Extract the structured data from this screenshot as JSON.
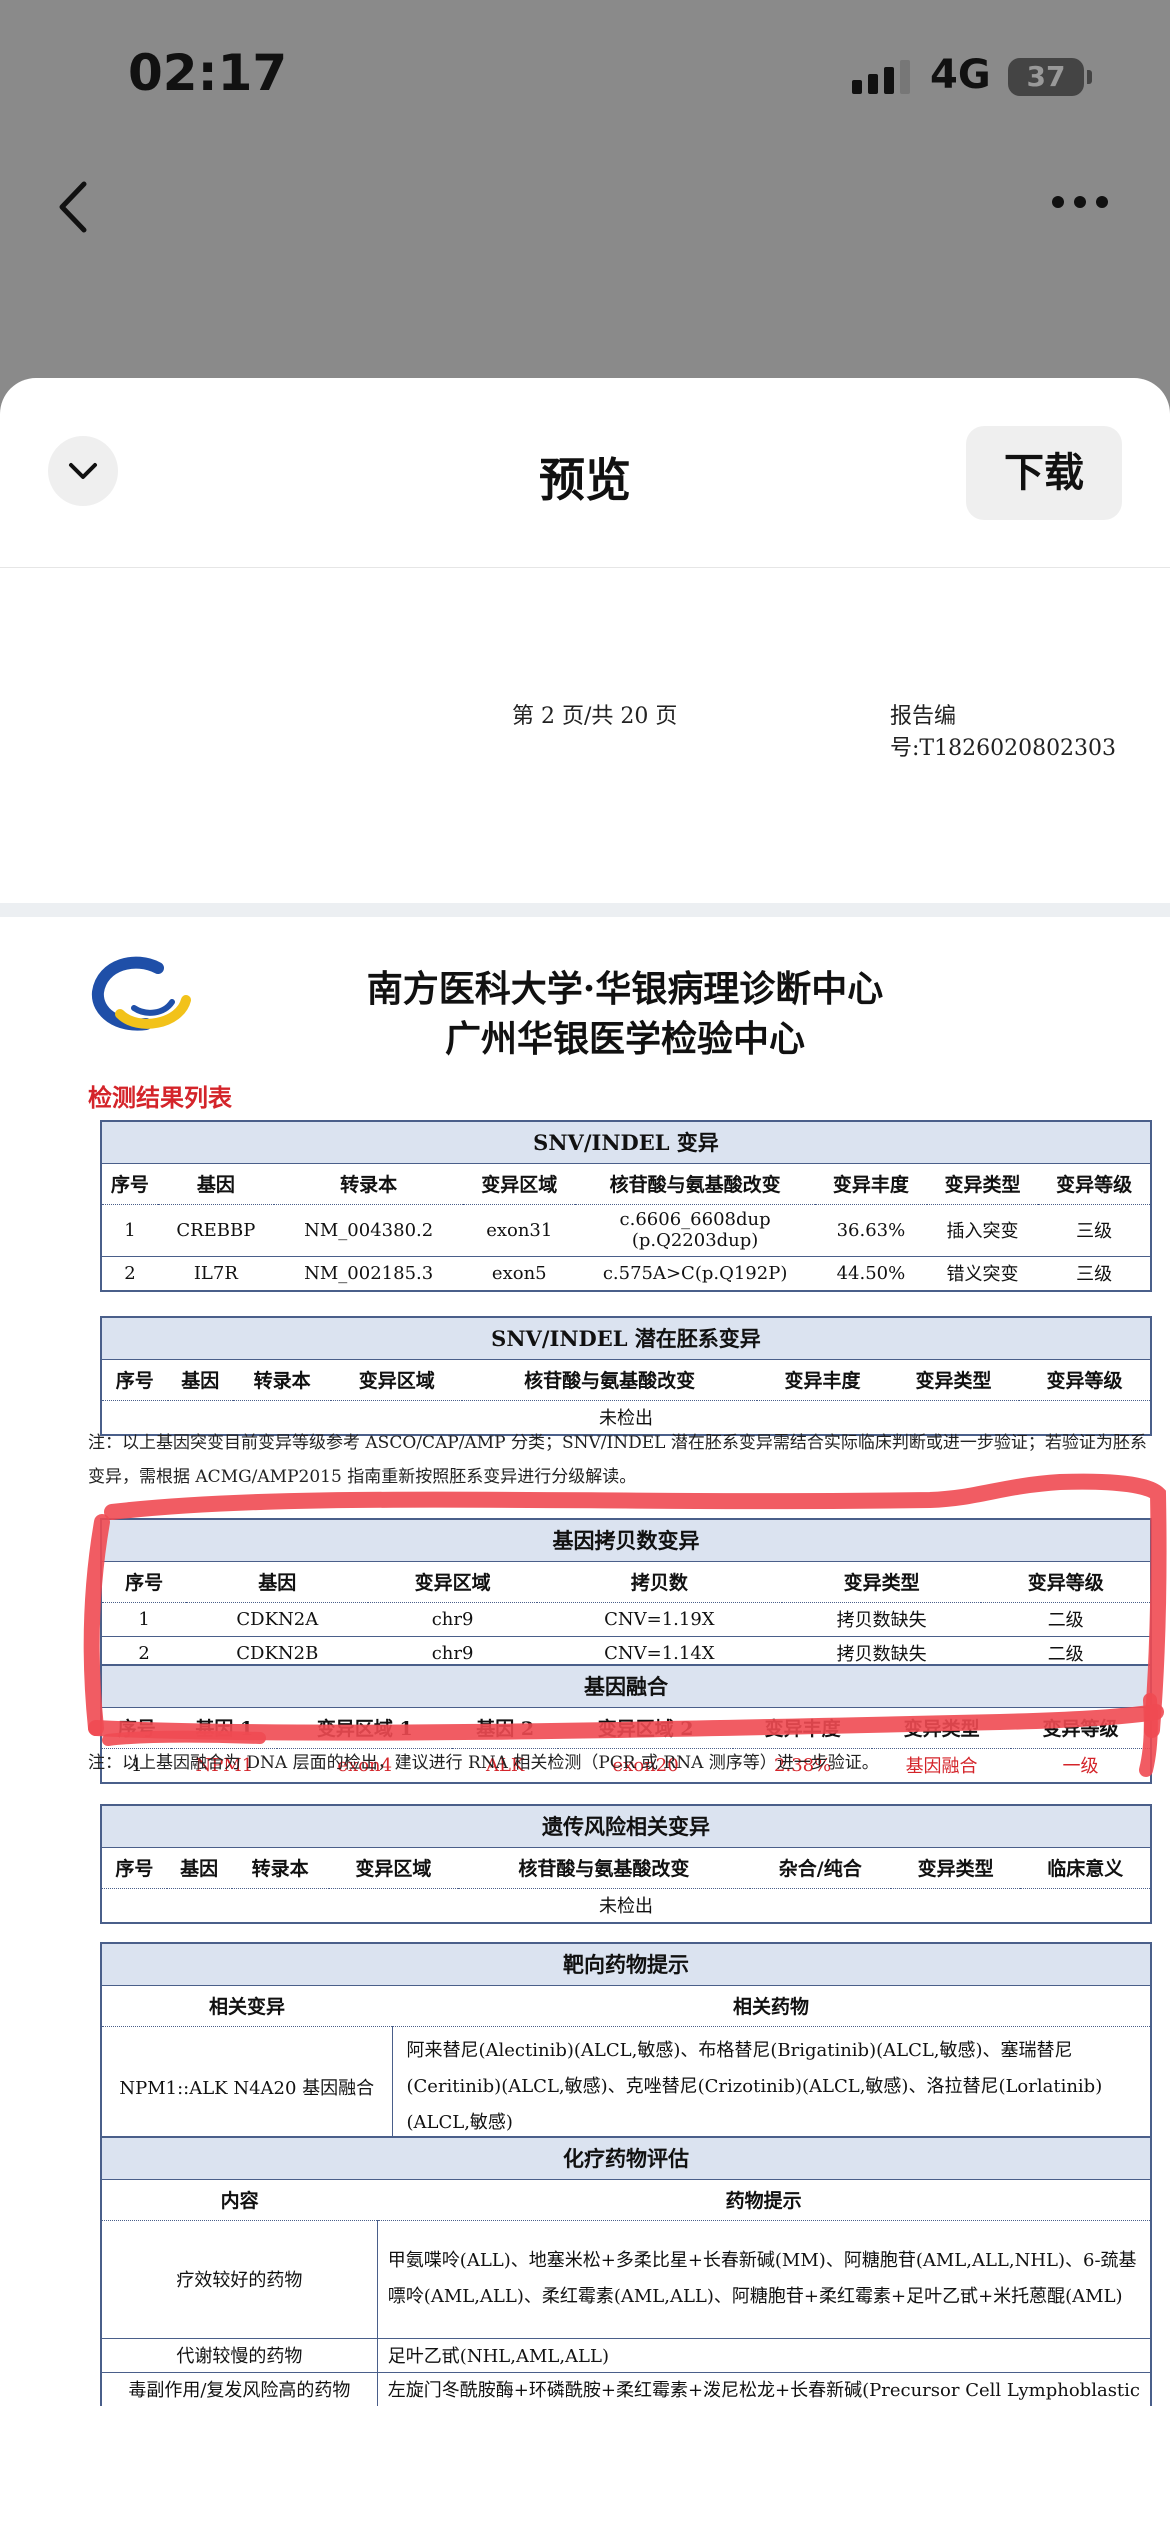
{
  "status": {
    "time": "02:17",
    "network": "4G",
    "battery": "37"
  },
  "sheet": {
    "title": "预览",
    "download_label": "下载"
  },
  "page_meta": {
    "page": "第 2 页/共 20 页",
    "report_no": "报告编号:T1826020802303"
  },
  "document": {
    "org_line1": "南方医科大学·华银病理诊断中心",
    "org_line2": "广州华银医学检验中心",
    "section_title": "检测结果列表",
    "snv": {
      "title": "SNV/INDEL 变异",
      "headers": [
        "序号",
        "基因",
        "转录本",
        "变异区域",
        "核苷酸与氨基酸改变",
        "变异丰度",
        "变异类型",
        "变异等级"
      ],
      "rows": [
        [
          "1",
          "CREBBP",
          "NM_004380.2",
          "exon31",
          "c.6606_6608dup (p.Q2203dup)",
          "36.63%",
          "插入突变",
          "三级"
        ],
        [
          "2",
          "IL7R",
          "NM_002185.3",
          "exon5",
          "c.575A>C(p.Q192P)",
          "44.50%",
          "错义突变",
          "三级"
        ]
      ]
    },
    "germline": {
      "title": "SNV/INDEL 潜在胚系变异",
      "headers": [
        "序号",
        "基因",
        "转录本",
        "变异区域",
        "核苷酸与氨基酸改变",
        "变异丰度",
        "变异类型",
        "变异等级"
      ],
      "empty": "未检出"
    },
    "note1": "注：以上基因突变目前变异等级参考 ASCO/CAP/AMP 分类；SNV/INDEL 潜在胚系变异需结合实际临床判断或进一步验证；若验证为胚系变异，需根据 ACMG/AMP2015 指南重新按照胚系变异进行分级解读。",
    "cnv": {
      "title": "基因拷贝数变异",
      "headers": [
        "序号",
        "基因",
        "变异区域",
        "拷贝数",
        "变异类型",
        "变异等级"
      ],
      "rows": [
        [
          "1",
          "CDKN2A",
          "chr9",
          "CNV=1.19X",
          "拷贝数缺失",
          "二级"
        ],
        [
          "2",
          "CDKN2B",
          "chr9",
          "CNV=1.14X",
          "拷贝数缺失",
          "二级"
        ]
      ]
    },
    "fusion": {
      "title": "基因融合",
      "headers": [
        "序号",
        "基因 1",
        "变异区域 1",
        "基因 2",
        "变异区域 2",
        "变异丰度",
        "变异类型",
        "变异等级"
      ],
      "rows": [
        [
          "1",
          "NPM1",
          "exon4",
          "ALK",
          "exon20",
          "2.38%",
          "基因融合",
          "一级"
        ]
      ]
    },
    "note2": "注：以上基因融合为 DNA 层面的检出，建议进行 RNA 相关检测（PCR 或 RNA 测序等）进一步验证。",
    "hereditary": {
      "title": "遗传风险相关变异",
      "headers": [
        "序号",
        "基因",
        "转录本",
        "变异区域",
        "核苷酸与氨基酸改变",
        "杂合/纯合",
        "变异类型",
        "临床意义"
      ],
      "empty": "未检出"
    },
    "targeted": {
      "title": "靶向药物提示",
      "headers": [
        "相关变异",
        "相关药物"
      ],
      "rows": [
        [
          "NPM1::ALK N4A20 基因融合",
          "阿来替尼(Alectinib)(ALCL,敏感)、布格替尼(Brigatinib)(ALCL,敏感)、塞瑞替尼(Ceritinib)(ALCL,敏感)、克唑替尼(Crizotinib)(ALCL,敏感)、洛拉替尼(Lorlatinib)(ALCL,敏感)"
        ]
      ]
    },
    "chemo": {
      "title": "化疗药物评估",
      "headers": [
        "内容",
        "药物提示"
      ],
      "rows": [
        [
          "疗效较好的药物",
          "甲氨喋呤(ALL)、地塞米松+多柔比星+长春新碱(MM)、阿糖胞苷(AML,ALL,NHL)、6-巯基嘌呤(AML,ALL)、柔红霉素(AML,ALL)、阿糖胞苷+柔红霉素+足叶乙甙+米托蒽醌(AML)"
        ],
        [
          "代谢较慢的药物",
          "足叶乙甙(NHL,AML,ALL)"
        ],
        [
          "毒副作用/复发风险高的药物",
          "左旋门冬酰胺酶+环磷酰胺+柔红霉素+泼尼松龙+长春新碱(Precursor Cell Lymphoblastic"
        ]
      ]
    }
  }
}
